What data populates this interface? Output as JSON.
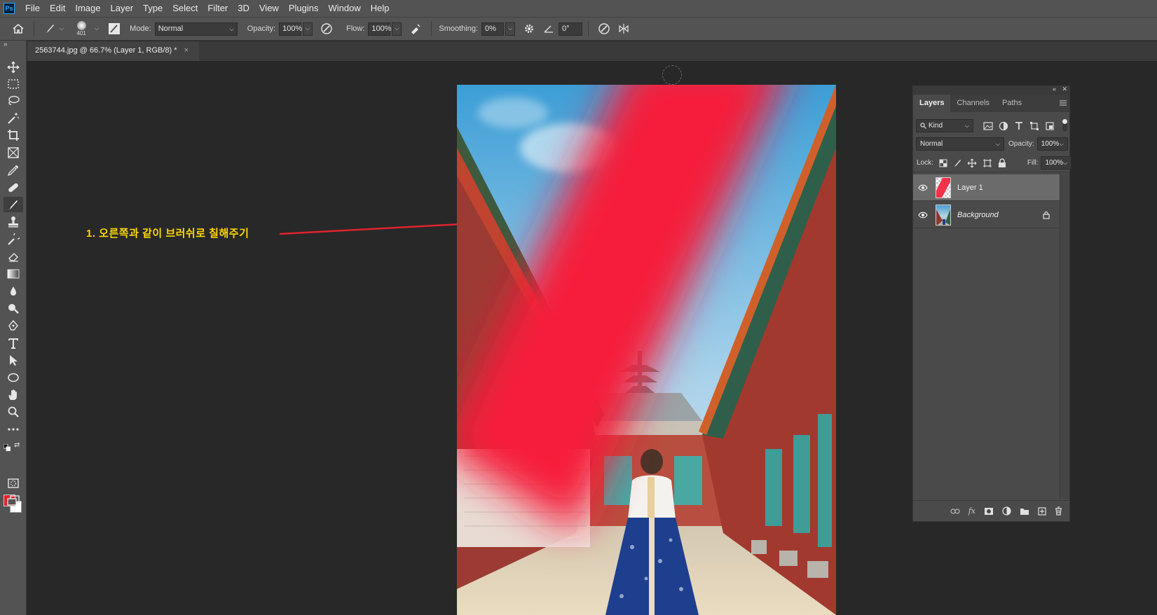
{
  "app": {
    "logo_text": "Ps"
  },
  "menu": [
    "File",
    "Edit",
    "Image",
    "Layer",
    "Type",
    "Select",
    "Filter",
    "3D",
    "View",
    "Plugins",
    "Window",
    "Help"
  ],
  "options": {
    "brush_size": "401",
    "mode_label": "Mode:",
    "mode_value": "Normal",
    "opacity_label": "Opacity:",
    "opacity_value": "100%",
    "flow_label": "Flow:",
    "flow_value": "100%",
    "smoothing_label": "Smoothing:",
    "smoothing_value": "0%",
    "angle_value": "0°"
  },
  "document": {
    "tab_title": "2563744.jpg @ 66.7% (Layer 1, RGB/8) *",
    "close_glyph": "×"
  },
  "annotation": {
    "text": "1. 오른쪽과 같이 브러쉬로 칠해주기",
    "color": "#ffd800",
    "arrow_color": "#e0232e"
  },
  "colors": {
    "foreground": "#e6202e",
    "background": "#ffffff",
    "brush_paint": "#f61d3a"
  },
  "layers_panel": {
    "tabs": [
      "Layers",
      "Channels",
      "Paths"
    ],
    "active_tab": "Layers",
    "filter_value": "Kind",
    "blend_mode": "Normal",
    "opacity_label": "Opacity:",
    "opacity_value": "100%",
    "lock_label": "Lock:",
    "fill_label": "Fill:",
    "fill_value": "100%",
    "layers": [
      {
        "name": "Layer 1",
        "selected": true,
        "locked": false
      },
      {
        "name": "Background",
        "selected": false,
        "locked": true
      }
    ],
    "footer_fx": "fx"
  }
}
